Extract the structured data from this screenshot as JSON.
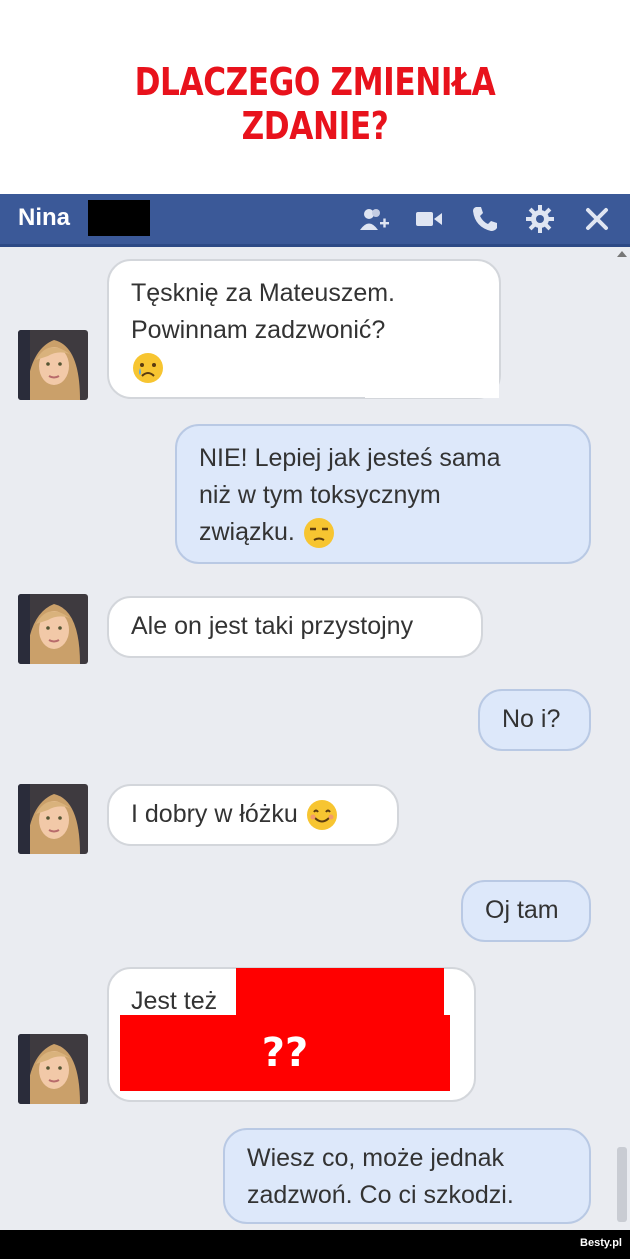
{
  "headline": "DLACZEGO ZMIENIŁA ZDANIE?",
  "chat": {
    "contact_name": "Nina",
    "toolbar_icons": [
      "add-friend-icon",
      "video-call-icon",
      "phone-icon",
      "gear-icon",
      "close-icon"
    ],
    "colors": {
      "header": "#3b5998",
      "incoming": "#ffffff",
      "outgoing": "#dde8fa",
      "background": "#eaecf1",
      "redaction": "#ff0000"
    },
    "messages": [
      {
        "from": "Nina",
        "lines": [
          "Tęsknię za Mateuszem.",
          "Powinnam zadzwonić?"
        ],
        "emoji": "crying-face-icon"
      },
      {
        "from": "me",
        "lines": [
          "NIE! Lepiej jak jesteś sama",
          "niż w tym toksycznym",
          "związku."
        ],
        "emoji": "unamused-face-icon"
      },
      {
        "from": "Nina",
        "lines": [
          "Ale on jest taki przystojny"
        ]
      },
      {
        "from": "me",
        "lines": [
          "No i?"
        ]
      },
      {
        "from": "Nina",
        "lines": [
          "I dobry w łóżku"
        ],
        "emoji": "smiling-face-icon"
      },
      {
        "from": "me",
        "lines": [
          "Oj tam"
        ]
      },
      {
        "from": "Nina",
        "lines": [
          "Jest też"
        ],
        "redacted_overlay": "??"
      },
      {
        "from": "me",
        "lines": [
          "Wiesz co, może jednak",
          "zadzwoń. Co ci szkodzi."
        ]
      }
    ]
  },
  "watermark": "Besty.pl"
}
